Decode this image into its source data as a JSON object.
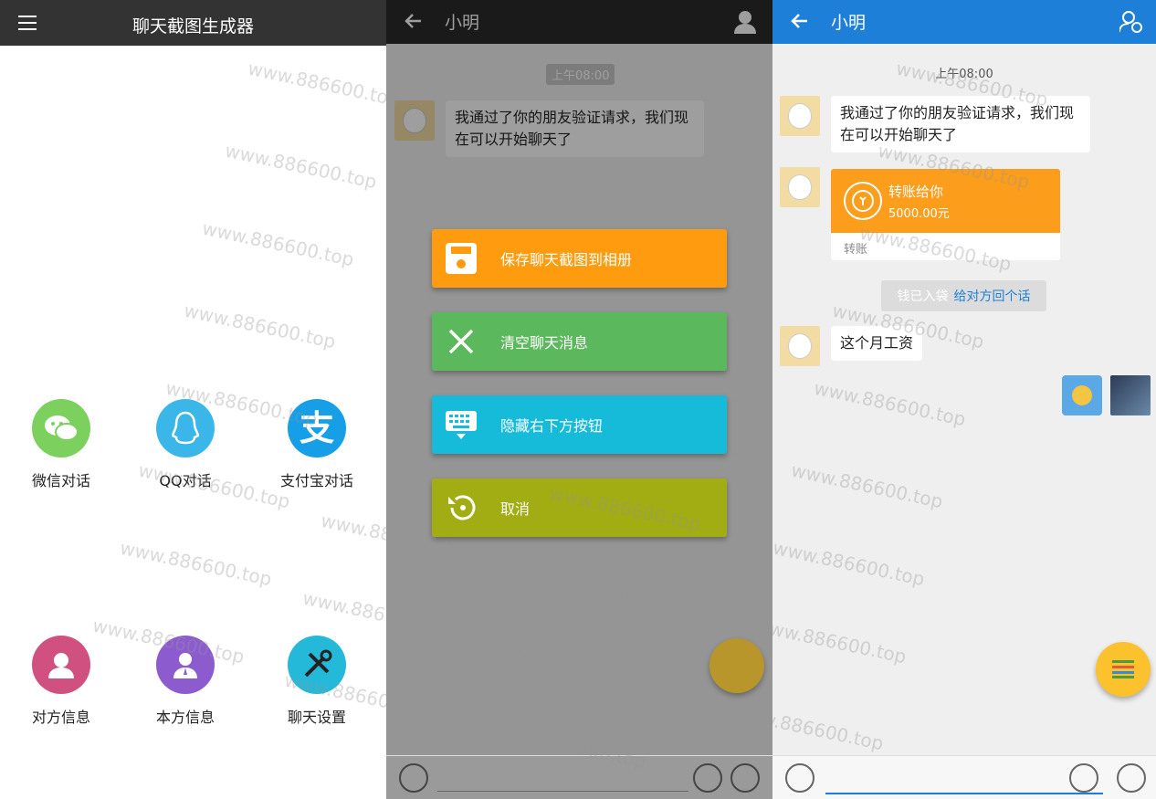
{
  "panel1": {
    "title": "聊天截图生成器",
    "items": [
      {
        "label": "微信对话",
        "icon": "wechat-icon",
        "color": "#7bd05e"
      },
      {
        "label": "QQ对话",
        "icon": "qq-icon",
        "color": "#3ab6e8"
      },
      {
        "label": "支付宝对话",
        "icon": "alipay-icon",
        "color": "#169ee6"
      },
      {
        "label": "对方信息",
        "icon": "person-female-icon",
        "color": "#d0517f"
      },
      {
        "label": "本方信息",
        "icon": "person-male-icon",
        "color": "#8c5ccf"
      },
      {
        "label": "聊天设置",
        "icon": "tools-icon",
        "color": "#25b9d9"
      }
    ]
  },
  "panel2": {
    "name": "小明",
    "time": "上午08:00",
    "message": "我通过了你的朋友验证请求，我们现在可以开始聊天了",
    "dialog": [
      {
        "label": "保存聊天截图到相册",
        "color": "#ff9b0f",
        "icon": "save-icon"
      },
      {
        "label": "清空聊天消息",
        "color": "#5cb85c",
        "icon": "close-icon"
      },
      {
        "label": "隐藏右下方按钮",
        "color": "#16bbd9",
        "icon": "keyboard-icon"
      },
      {
        "label": "取消",
        "color": "#a1ad12",
        "icon": "undo-icon"
      }
    ]
  },
  "panel3": {
    "name": "小明",
    "time": "上午08:00",
    "message1": "我通过了你的朋友验证请求，我们现在可以开始聊天了",
    "transfer_title": "转账给你",
    "transfer_amount": "5000.00元",
    "transfer_footer": "转账",
    "notice_gray": "钱已入袋",
    "notice_link": "给对方回个话",
    "message2": "这个月工资",
    "accent": "#1e7fd8"
  },
  "watermark": "www.886600.top"
}
